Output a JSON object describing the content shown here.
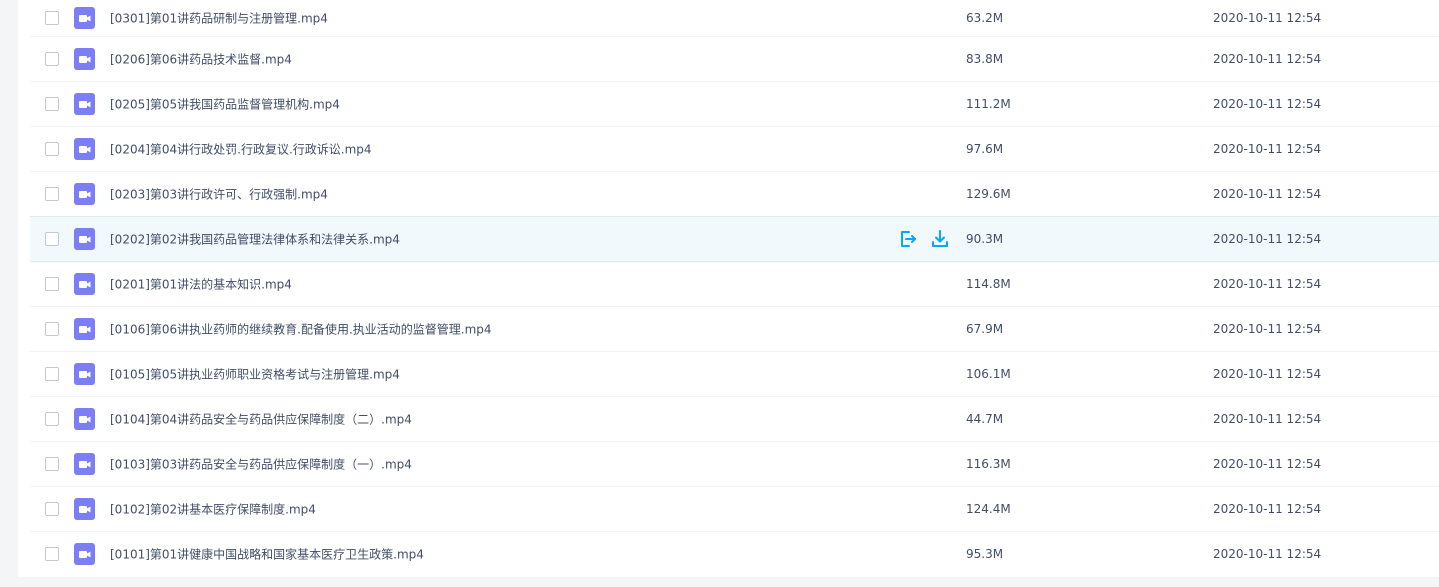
{
  "colors": {
    "video_icon": "#7b7ef5",
    "action_icon": "#06a7ff",
    "hover_row": "#f1f9fd",
    "text": "#424e67"
  },
  "files": [
    {
      "name": "[0301]第01讲药品研制与注册管理.mp4",
      "size": "63.2M",
      "date": "2020-10-11 12:54"
    },
    {
      "name": "[0206]第06讲药品技术监督.mp4",
      "size": "83.8M",
      "date": "2020-10-11 12:54"
    },
    {
      "name": "[0205]第05讲我国药品监督管理机构.mp4",
      "size": "111.2M",
      "date": "2020-10-11 12:54"
    },
    {
      "name": "[0204]第04讲行政处罚.行政复议.行政诉讼.mp4",
      "size": "97.6M",
      "date": "2020-10-11 12:54"
    },
    {
      "name": "[0203]第03讲行政许可、行政强制.mp4",
      "size": "129.6M",
      "date": "2020-10-11 12:54"
    },
    {
      "name": "[0202]第02讲我国药品管理法律体系和法律关系.mp4",
      "size": "90.3M",
      "date": "2020-10-11 12:54"
    },
    {
      "name": "[0201]第01讲法的基本知识.mp4",
      "size": "114.8M",
      "date": "2020-10-11 12:54"
    },
    {
      "name": "[0106]第06讲执业药师的继续教育.配备使用.执业活动的监督管理.mp4",
      "size": "67.9M",
      "date": "2020-10-11 12:54"
    },
    {
      "name": "[0105]第05讲执业药师职业资格考试与注册管理.mp4",
      "size": "106.1M",
      "date": "2020-10-11 12:54"
    },
    {
      "name": "[0104]第04讲药品安全与药品供应保障制度（二）.mp4",
      "size": "44.7M",
      "date": "2020-10-11 12:54"
    },
    {
      "name": "[0103]第03讲药品安全与药品供应保障制度（一）.mp4",
      "size": "116.3M",
      "date": "2020-10-11 12:54"
    },
    {
      "name": "[0102]第02讲基本医疗保障制度.mp4",
      "size": "124.4M",
      "date": "2020-10-11 12:54"
    },
    {
      "name": "[0101]第01讲健康中国战略和国家基本医疗卫生政策.mp4",
      "size": "95.3M",
      "date": "2020-10-11 12:54"
    }
  ],
  "hover_row_index": 5,
  "row_actions": [
    {
      "icon": "share-icon"
    },
    {
      "icon": "download-icon"
    }
  ]
}
